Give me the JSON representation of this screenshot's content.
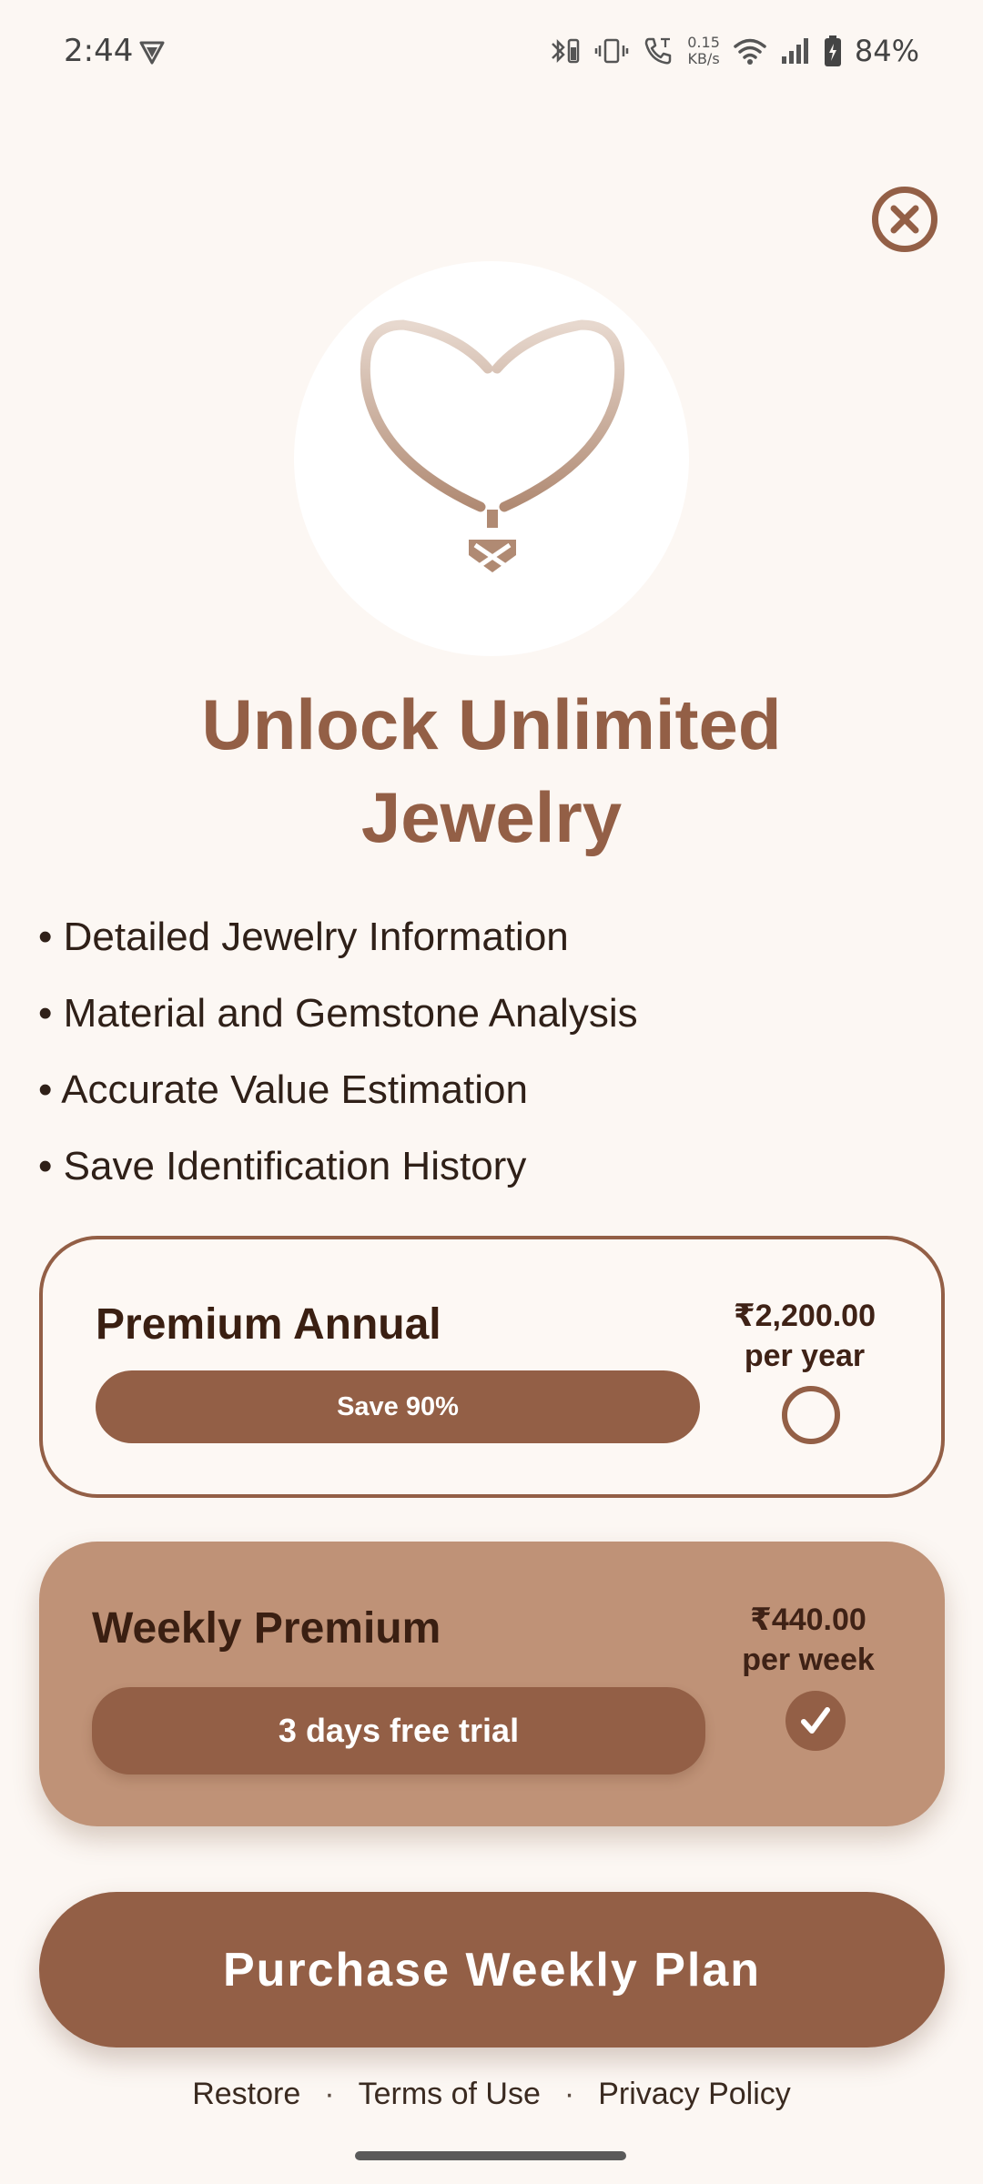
{
  "status_bar": {
    "time": "2:44",
    "net_speed_value": "0.15",
    "net_speed_unit": "KB/s",
    "battery_percent": "84%",
    "icons": [
      "vpn-icon",
      "bluetooth-icon",
      "vibrate-icon",
      "call-icon",
      "wifi-icon",
      "signal-icon",
      "battery-icon"
    ]
  },
  "close_icon": "close-icon",
  "hero_icon": "necklace-icon",
  "headline": {
    "line1": "Unlock Unlimited",
    "line2": "Jewelry"
  },
  "features": [
    "• Detailed Jewelry Information",
    "• Material and Gemstone Analysis",
    "• Accurate Value Estimation",
    "• Save Identification History"
  ],
  "plans": [
    {
      "title": "Premium Annual",
      "badge": "Save 90%",
      "price": "₹2,200.00",
      "period": "per year",
      "selected": false
    },
    {
      "title": "Weekly Premium",
      "badge": "3 days free trial",
      "price": "₹440.00",
      "period": "per week",
      "selected": true
    }
  ],
  "cta_label": "Purchase Weekly Plan",
  "footer": {
    "restore": "Restore",
    "separator": "·",
    "terms": "Terms of Use",
    "privacy": "Privacy Policy"
  },
  "colors": {
    "background": "#fcf7f3",
    "accent": "#935f46",
    "selected_card": "#bf9277",
    "text_dark": "#3a1f12"
  }
}
